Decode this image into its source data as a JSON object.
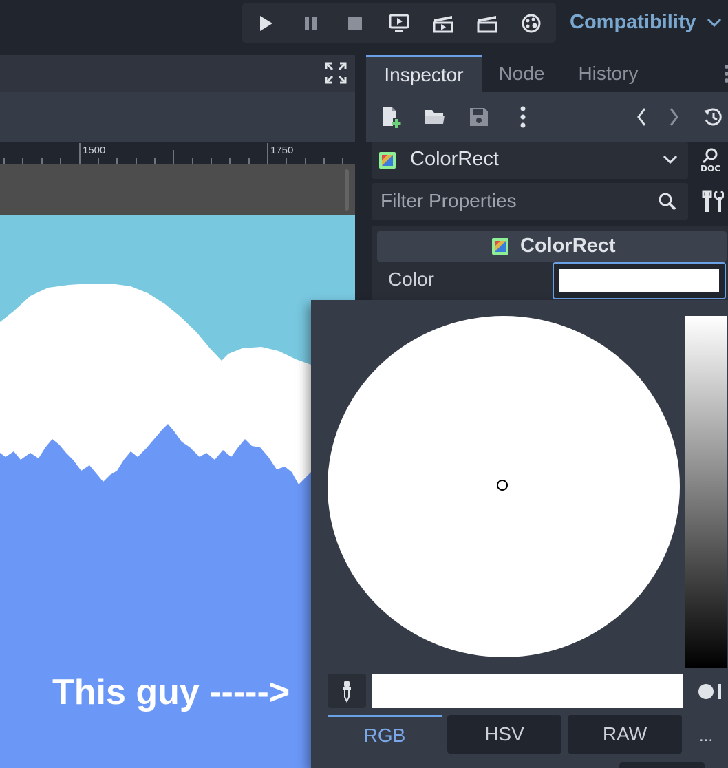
{
  "toolbar": {
    "buttons": [
      "play-icon",
      "pause-icon",
      "stop-icon",
      "play-current-scene-icon",
      "play-movie-icon",
      "movie-maker-icon",
      "remote-debug-icon"
    ],
    "render_mode": "Compatibility"
  },
  "ruler": {
    "tick_labels": [
      "1500",
      "1750"
    ]
  },
  "viewport": {
    "caption": "This guy ----->",
    "colors": {
      "sky": "#78c8e0",
      "ground": "#6b97f7",
      "cloud": "#ffffff",
      "gray_band": "#4d4d4d"
    }
  },
  "inspector": {
    "tabs": [
      "Inspector",
      "Node",
      "History"
    ],
    "selected_object": "ColorRect",
    "filter_placeholder": "Filter Properties",
    "section_title": "ColorRect",
    "property_label": "Color",
    "property_value_color": "#ffffff"
  },
  "color_picker": {
    "selected_color": "#ffffff",
    "modes": [
      "RGB",
      "HSV",
      "RAW"
    ],
    "active_mode": "RGB",
    "more_label": "..."
  }
}
